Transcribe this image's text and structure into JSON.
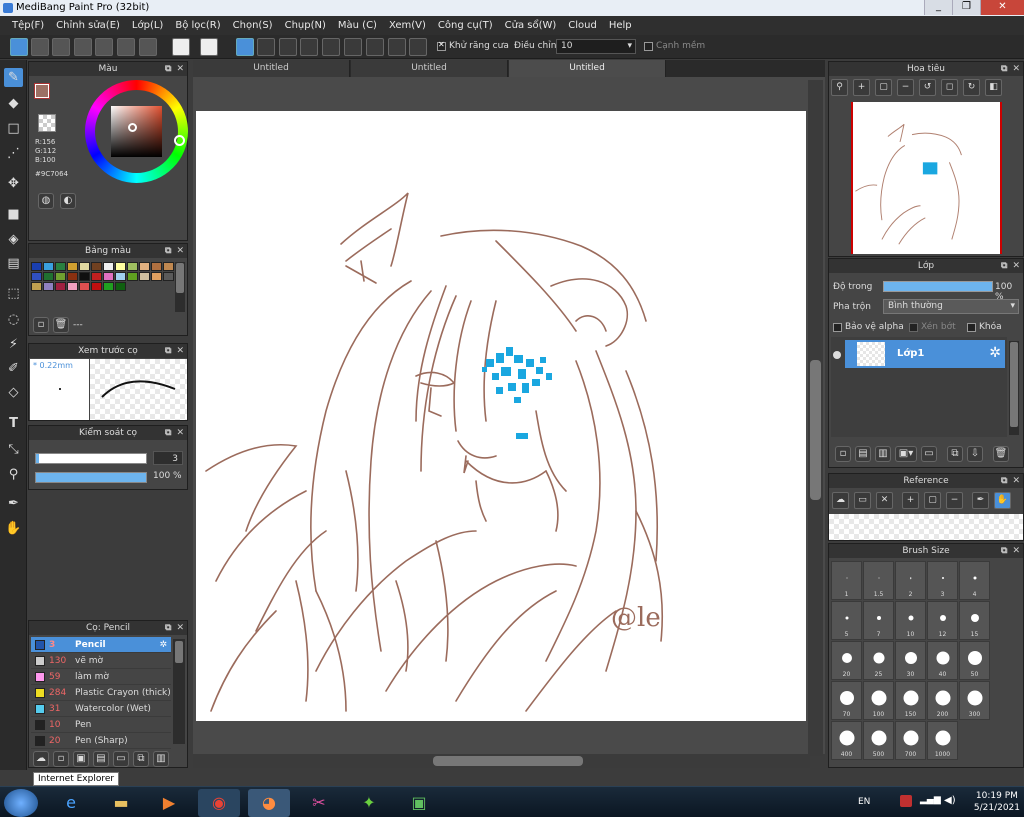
{
  "window": {
    "title": "MediBang Paint Pro (32bit)",
    "min": "_",
    "max": "❐",
    "close": "✕"
  },
  "menu": [
    "Tệp(F)",
    "Chỉnh sửa(E)",
    "Lớp(L)",
    "Bộ lọc(R)",
    "Chọn(S)",
    "Chụp(N)",
    "Màu (C)",
    "Xem(V)",
    "Công cụ(T)",
    "Cửa sổ(W)",
    "Cloud",
    "Help"
  ],
  "toolbar": {
    "antialias_label": "Khử răng cưa",
    "antialias_checked": true,
    "adjust_label": "Điều chỉnh",
    "adjust_value": "10",
    "smooth_label": "Cạnh mềm",
    "smooth_checked": false
  },
  "color_panel": {
    "title": "Màu",
    "r": "R:156",
    "g": "G:112",
    "b": "B:100",
    "hex": "#9C7064",
    "fg_color": "#9C7064"
  },
  "palette_panel": {
    "title": "Bảng màu",
    "colors": [
      "#1a3fb0",
      "#3aa0e0",
      "#2a8040",
      "#d0a030",
      "#e0d8a0",
      "#704020",
      "#f0f0f0",
      "#ffffa0",
      "#a0c060",
      "#e0b080",
      "#b07040",
      "#c08850",
      "#3050c0",
      "#207030",
      "#70a030",
      "#8a3010",
      "#101010",
      "#c02020",
      "#e070c0",
      "#a0d0f0",
      "#60a020",
      "#d0c0a0",
      "#e0a060",
      "#5a5a5a",
      "#c0a050",
      "#9080c0",
      "#a02040",
      "#f0a0c0",
      "#e05050",
      "#c01010",
      "#20a020",
      "#106010"
    ],
    "more": "---"
  },
  "preview_panel": {
    "title": "Xem trước cọ",
    "size": "* 0.22mm"
  },
  "control_panel": {
    "title": "Kiểm soát cọ",
    "size_value": "3",
    "opacity_value": "100 %",
    "opacity": 1.0
  },
  "brush_panel": {
    "title": "Cọ: Pencil",
    "brushes": [
      {
        "size": "3",
        "name": "Pencil",
        "color": "#2255aa",
        "selected": true
      },
      {
        "size": "130",
        "name": "vẽ mờ",
        "color": "#cccccc",
        "selected": false
      },
      {
        "size": "59",
        "name": "làm mờ",
        "color": "#ff99ee",
        "selected": false
      },
      {
        "size": "284",
        "name": "Plastic Crayon (thick)",
        "color": "#eedd22",
        "selected": false
      },
      {
        "size": "31",
        "name": "Watercolor (Wet)",
        "color": "#55ccee",
        "selected": false
      },
      {
        "size": "10",
        "name": "Pen",
        "color": "#222222",
        "selected": false
      },
      {
        "size": "20",
        "name": "Pen (Sharp)",
        "color": "#222222",
        "selected": false
      }
    ]
  },
  "tooltip": "Internet Explorer",
  "tabs": [
    "Untitled",
    "Untitled",
    "Untitled"
  ],
  "active_tab": 2,
  "signature": "@le",
  "navigator": {
    "title": "Hoa tiêu"
  },
  "layer_panel": {
    "title": "Lớp",
    "opacity_label": "Độ trong",
    "opacity_value": "100 %",
    "opacity": 1.0,
    "blend_label": "Pha trộn",
    "blend_value": "Bình thường",
    "protect_alpha": "Bảo vệ alpha",
    "clipping": "Xén bớt",
    "lock": "Khóa",
    "layer_name": "Lớp1"
  },
  "reference_panel": {
    "title": "Reference"
  },
  "brush_size_panel": {
    "title": "Brush Size",
    "sizes": [
      "1",
      "1.5",
      "2",
      "3",
      "4",
      "5",
      "7",
      "10",
      "12",
      "15",
      "20",
      "25",
      "30",
      "40",
      "50",
      "70",
      "100",
      "150",
      "200",
      "300",
      "400",
      "500",
      "700",
      "1000"
    ]
  },
  "taskbar": {
    "lang": "EN",
    "time": "10:19 PM",
    "date": "5/21/2021"
  }
}
